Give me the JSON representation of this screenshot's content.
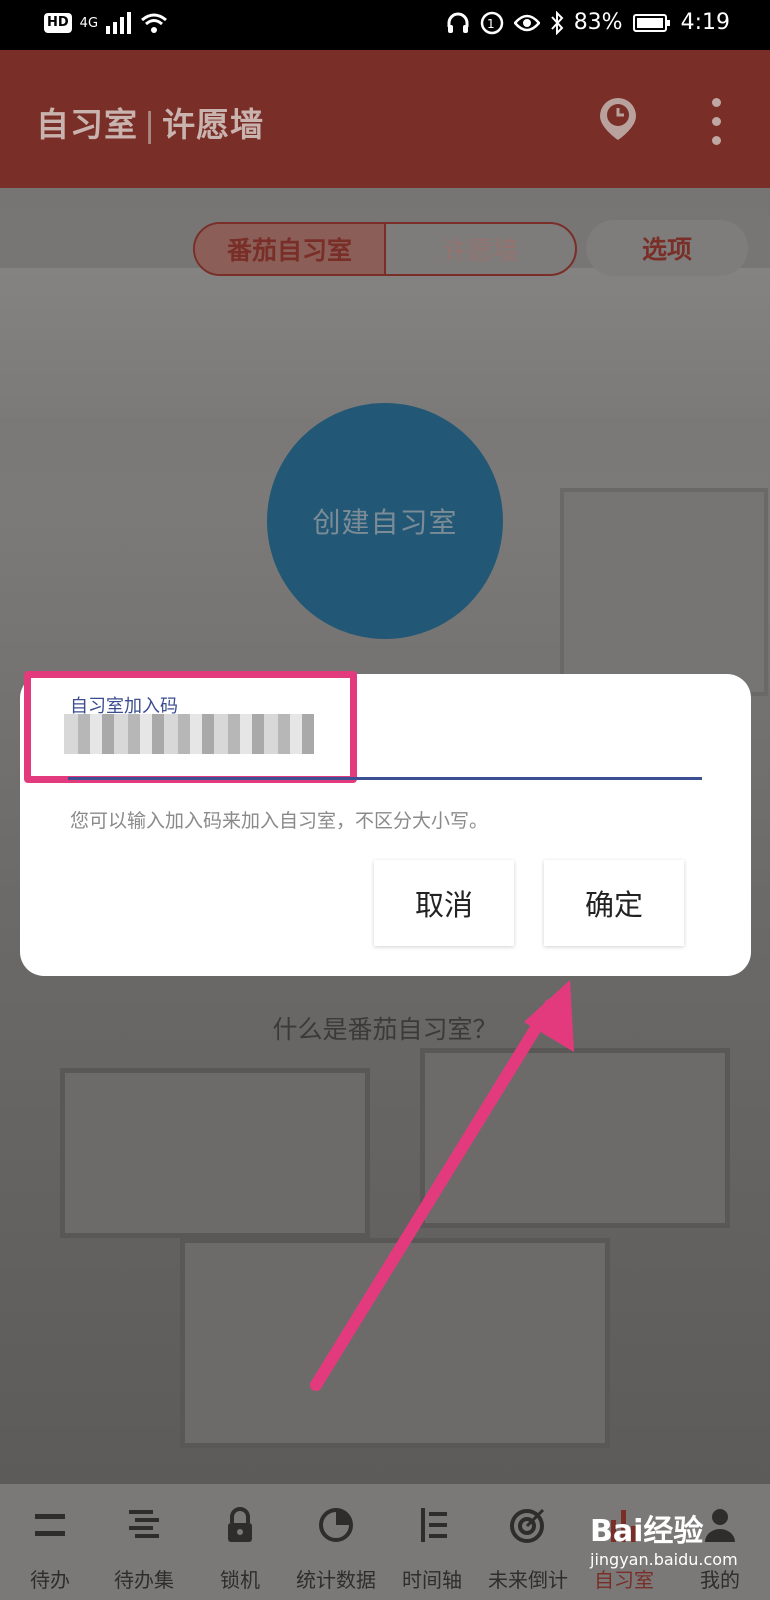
{
  "status_bar": {
    "network": "4G",
    "battery": "83%",
    "time": "4:19"
  },
  "app_bar": {
    "title": "自习室",
    "title_separator": "|",
    "title_secondary": "许愿墙"
  },
  "segmented": {
    "tabs": [
      {
        "label": "番茄自习室",
        "active": true
      },
      {
        "label": "许愿墙",
        "active": false
      }
    ],
    "options_label": "选项"
  },
  "create_room_label": "创建自习室",
  "what_is_label": "什么是番茄自习室？",
  "dialog": {
    "field_label": "自习室加入码",
    "hint": "您可以输入加入码来加入自习室，不区分大小写。",
    "cancel_label": "取消",
    "confirm_label": "确定"
  },
  "bottom_nav": [
    {
      "label": "待办",
      "icon": "list-icon"
    },
    {
      "label": "待办集",
      "icon": "list-group-icon"
    },
    {
      "label": "锁机",
      "icon": "lock-icon"
    },
    {
      "label": "统计数据",
      "icon": "pie-chart-icon"
    },
    {
      "label": "时间轴",
      "icon": "timeline-icon"
    },
    {
      "label": "未来倒计",
      "icon": "target-icon"
    },
    {
      "label": "自习室",
      "icon": "bar-chart-icon"
    },
    {
      "label": "我的",
      "icon": "person-icon"
    }
  ],
  "watermark": {
    "logo": "Bai经验",
    "url": "jingyan.baidu.com"
  },
  "colors": {
    "app_bar": "#7a2e28",
    "accent_line": "#3d4f93",
    "highlight": "#e33a7d",
    "create_circle": "#225875"
  }
}
